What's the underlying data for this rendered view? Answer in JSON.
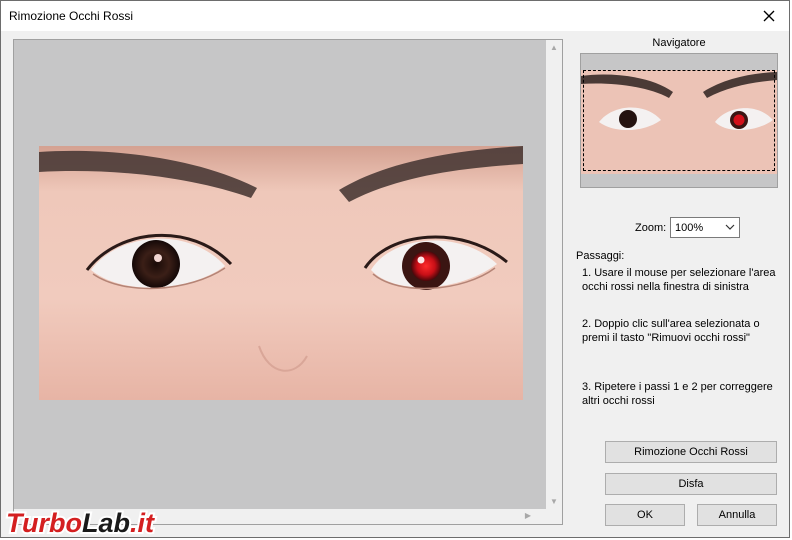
{
  "window": {
    "title": "Rimozione Occhi Rossi"
  },
  "navigator": {
    "title": "Navigatore"
  },
  "zoom": {
    "label": "Zoom:",
    "value": "100%"
  },
  "steps": {
    "title": "Passaggi:",
    "items": [
      {
        "text": "1. Usare il mouse per selezionare l'area occhi rossi nella finestra di sinistra"
      },
      {
        "text": "2. Doppio clic sull'area selezionata o premi il tasto \"Rimuovi occhi rossi\""
      },
      {
        "text": "3. Ripetere i passi 1 e 2 per correggere altri occhi rossi"
      }
    ]
  },
  "buttons": {
    "remove": "Rimozione Occhi Rossi",
    "undo": "Disfa",
    "ok": "OK",
    "cancel": "Annulla"
  },
  "watermark": {
    "part1": "Turbo",
    "part2": "Lab",
    "part3": ".it"
  },
  "colors": {
    "dialog_bg": "#f0f0f0",
    "viewer_bg": "#c6c6c7",
    "skin": "#eec3b5",
    "red_eye": "#d4101a",
    "watermark_red": "#d41f20"
  },
  "icons": {
    "close": "close-icon",
    "dropdown": "chevron-down-icon"
  }
}
